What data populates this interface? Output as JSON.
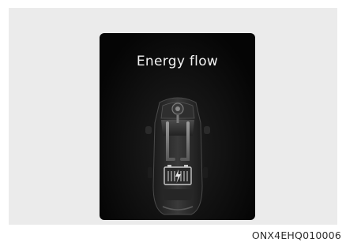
{
  "screen": {
    "title": "Energy flow"
  },
  "icons": {
    "vehicle": "car-top-view-icon",
    "battery": "battery-icon",
    "motor": "motor-icon"
  },
  "colors": {
    "background": "#ebebeb",
    "screen": "#0a0a0a",
    "title_text": "#f2f2f2"
  },
  "figure": {
    "code": "ONX4EHQ010006"
  }
}
